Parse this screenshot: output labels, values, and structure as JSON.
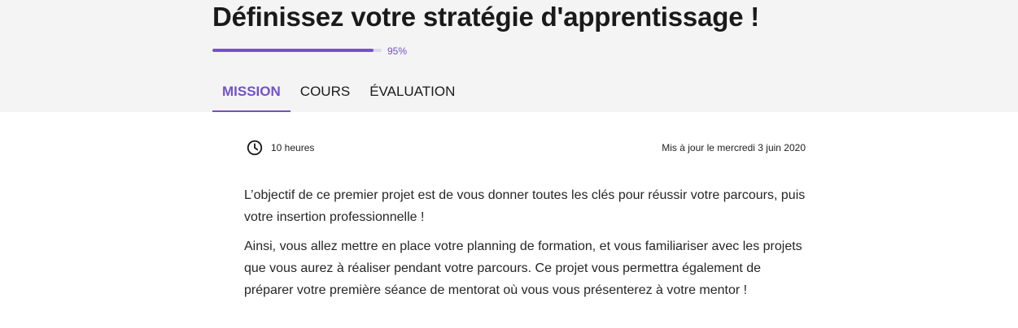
{
  "header": {
    "title": "Définissez votre stratégie d'apprentissage !",
    "progress_percent": 95,
    "progress_label": "95%"
  },
  "tabs": [
    {
      "label": "MISSION",
      "active": true
    },
    {
      "label": "COURS",
      "active": false
    },
    {
      "label": "ÉVALUATION",
      "active": false
    }
  ],
  "meta": {
    "icon": "clock-icon",
    "duration": "10 heures",
    "updated": "Mis à jour le mercredi 3 juin 2020"
  },
  "content": {
    "paragraphs": [
      "L’objectif de ce premier projet est de vous donner toutes les clés pour réussir votre parcours, puis votre insertion professionnelle !",
      "Ainsi, vous allez mettre en place votre planning de formation, et vous familiariser avec les projets que vous aurez à réaliser pendant votre parcours. Ce projet vous permettra également de préparer votre première séance de mentorat où vous vous présenterez à votre mentor !"
    ]
  },
  "colors": {
    "accent": "#7451c9",
    "header_bg": "#f4f4f4"
  }
}
